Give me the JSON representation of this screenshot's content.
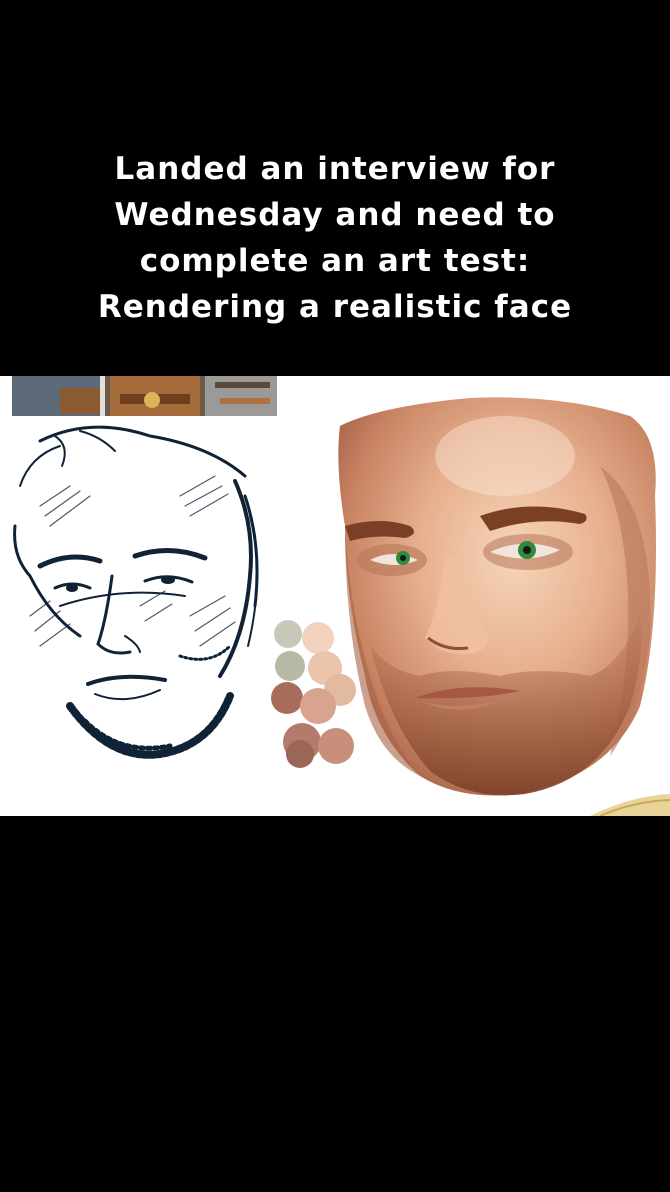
{
  "caption": {
    "lines": [
      "Landed an interview for",
      "Wednesday and need to",
      "complete an art test:",
      "Rendering a realistic face"
    ]
  },
  "artwork": {
    "items": [
      {
        "icon": "character-costume-crop"
      },
      {
        "icon": "sketch-face-icon"
      },
      {
        "icon": "color-swatches-icon"
      },
      {
        "icon": "painted-face-icon"
      }
    ],
    "colors": {
      "ink": "#0f2236",
      "skin_light": "#f1c9a8",
      "skin_mid": "#d9987a",
      "skin_dark": "#9a5a3e",
      "beard": "#8a4f34",
      "eye": "#2f8a3a",
      "swatches": [
        "#c8c8b8",
        "#f3d2bd",
        "#b8b8a6",
        "#ecc3ab",
        "#d8a48f",
        "#a76c5a",
        "#c98e7c",
        "#b37c6a",
        "#9a6656"
      ]
    }
  }
}
